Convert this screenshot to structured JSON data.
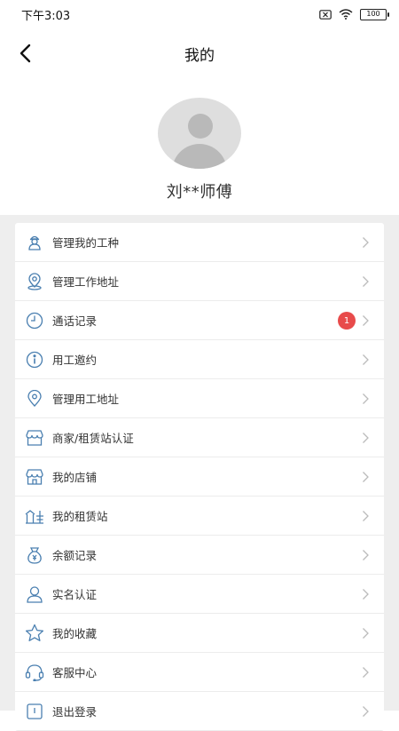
{
  "status_bar": {
    "time": "下午3:03",
    "battery": "100"
  },
  "header": {
    "title": "我的"
  },
  "profile": {
    "name": "刘**师傅"
  },
  "menu": {
    "items": [
      {
        "label": "管理我的工种",
        "icon": "worker-icon"
      },
      {
        "label": "管理工作地址",
        "icon": "location-icon"
      },
      {
        "label": "通话记录",
        "icon": "clock-icon",
        "badge": "1"
      },
      {
        "label": "用工邀约",
        "icon": "info-icon"
      },
      {
        "label": "管理用工地址",
        "icon": "map-pin-icon"
      },
      {
        "label": "商家/租赁站认证",
        "icon": "store-icon"
      },
      {
        "label": "我的店铺",
        "icon": "shop-icon"
      },
      {
        "label": "我的租赁站",
        "icon": "rental-station-icon"
      },
      {
        "label": "余额记录",
        "icon": "money-bag-icon"
      },
      {
        "label": "实名认证",
        "icon": "user-icon"
      },
      {
        "label": "我的收藏",
        "icon": "star-icon"
      },
      {
        "label": "客服中心",
        "icon": "headset-icon"
      },
      {
        "label": "退出登录",
        "icon": "logout-icon"
      }
    ]
  },
  "colors": {
    "icon_blue": "#4a7fb0",
    "badge_red": "#e84b4b",
    "background_gray": "#eeeeee"
  }
}
